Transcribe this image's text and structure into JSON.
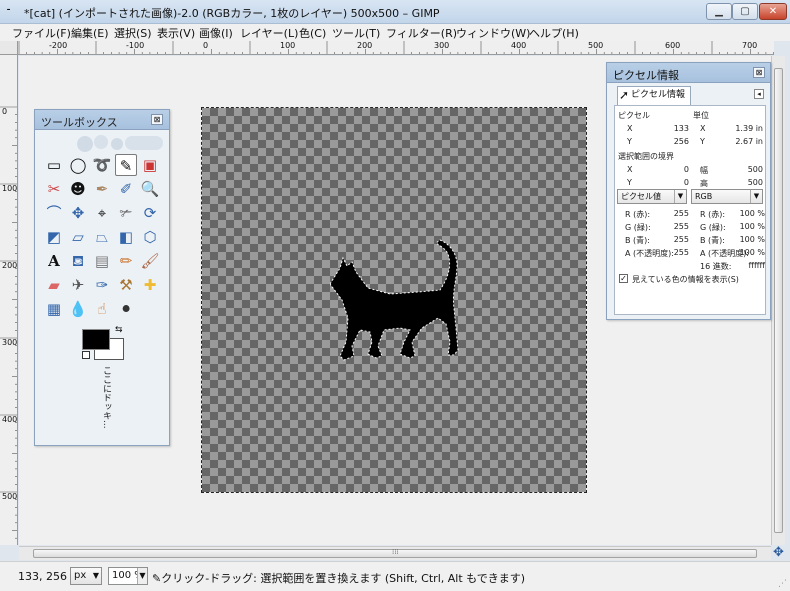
{
  "window": {
    "title": "*[cat] (インポートされた画像)-2.0 (RGBカラー, 1枚のレイヤー) 500x500 – GIMP",
    "minimize": "▁",
    "maximize": "▢",
    "close": "✕"
  },
  "menu": [
    "ファイル(F)",
    "編集(E)",
    "選択(S)",
    "表示(V)",
    "画像(I)",
    "レイヤー(L)",
    "色(C)",
    "ツール(T)",
    "フィルター(R)",
    "ウィンドウ(W)",
    "ヘルプ(H)"
  ],
  "ruler_top": [
    "-200",
    "-100",
    "0",
    "100",
    "200",
    "300",
    "400",
    "500",
    "600",
    "700"
  ],
  "ruler_left": [
    "0",
    "100",
    "200",
    "300",
    "400",
    "500"
  ],
  "toolbox": {
    "title": "ツールボックス",
    "close": "⊠",
    "dock_hint": "ここにドッキ..."
  },
  "pointer_info": {
    "title": "ピクセル情報",
    "close": "⊠",
    "tab_label": "ピクセル情報",
    "section_pixels": "ピクセル",
    "section_units": "単位",
    "px_x_label": "X",
    "px_x": "133",
    "px_y_label": "Y",
    "px_y": "256",
    "unit_x_label": "X",
    "unit_x": "1.39 in",
    "unit_y_label": "Y",
    "unit_y": "2.67 in",
    "section_selection": "選択範囲の境界",
    "sel_x_label": "X",
    "sel_x": "0",
    "sel_y_label": "Y",
    "sel_y": "0",
    "sel_w_label": "幅",
    "sel_w": "500",
    "sel_h_label": "高",
    "sel_h": "500",
    "dropdown_left": "ピクセル値",
    "dropdown_right": "RGB",
    "left_rows": [
      {
        "label": "R (赤):",
        "value": "255"
      },
      {
        "label": "G (緑):",
        "value": "255"
      },
      {
        "label": "B (青):",
        "value": "255"
      },
      {
        "label": "A (不透明度):",
        "value": "255"
      }
    ],
    "right_rows": [
      {
        "label": "R (赤):",
        "value": "100 %"
      },
      {
        "label": "G (緑):",
        "value": "100 %"
      },
      {
        "label": "B (青):",
        "value": "100 %"
      },
      {
        "label": "A (不透明度):",
        "value": "100 %"
      }
    ],
    "hex_label": "16 進数:",
    "hex_value": "ffffff",
    "sample_merged_checked": true,
    "sample_merged_label": "見えている色の情報を表示(S)"
  },
  "status": {
    "coords": "133, 256",
    "unit": "px",
    "zoom": "100 %",
    "message": "クリック-ドラッグ: 選択範囲を置き換えます (Shift, Ctrl, Alt もできます)"
  },
  "colors": {
    "foreground": "#000000",
    "background": "#ffffff"
  }
}
